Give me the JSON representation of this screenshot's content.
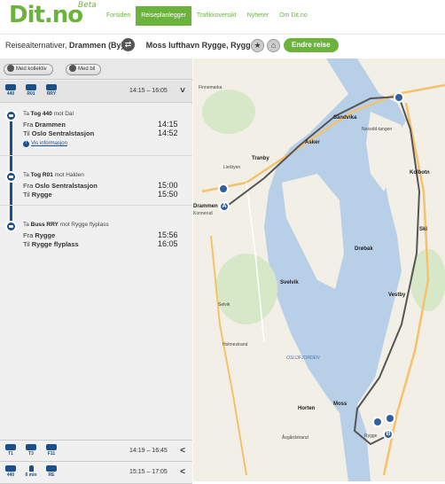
{
  "header": {
    "logo": "Dit.no",
    "logo_beta": "Beta",
    "nav": [
      "Forsiden",
      "Reiseplanlegger",
      "Trafikkoversikt",
      "Nyheter",
      "Om Dit.no"
    ]
  },
  "route": {
    "prefix": "Reisealternativer, ",
    "from": "Drammen (By)",
    "to": "Moss lufthavn Rygge, Rygge",
    "swap_icon": "swap-arrows-icon",
    "change_label": "Endre reise"
  },
  "modes": {
    "transit_label": "Med kollektiv",
    "car_label": "Med bil"
  },
  "alternatives": [
    {
      "legs": [
        {
          "icon": "train-icon",
          "code": "440"
        },
        {
          "icon": "train-icon",
          "code": "R01"
        },
        {
          "icon": "bus-icon",
          "code": "RRY"
        }
      ],
      "time": "14:15 – 16:05",
      "chevron": "˅"
    },
    {
      "legs": [
        {
          "icon": "bus-icon",
          "code": "T1"
        },
        {
          "icon": "bus-icon",
          "code": "T3"
        },
        {
          "icon": "ferry-icon",
          "code": "F11"
        }
      ],
      "time": "14:19 – 16:45",
      "chevron": "<"
    },
    {
      "legs": [
        {
          "icon": "train-icon",
          "code": "440"
        },
        {
          "icon": "walk-icon",
          "code": "6 min"
        },
        {
          "icon": "train-icon",
          "code": "RE"
        }
      ],
      "time": "15:15 – 17:05",
      "chevron": "<"
    }
  ],
  "steps": [
    {
      "head_prefix": "Ta ",
      "vehicle": "Tog 440",
      "head_suffix": " mot Dal",
      "from_label": "Fra",
      "from": "Drammen",
      "to_label": "Til",
      "to": "Oslo Sentralstasjon",
      "dep": "14:15",
      "arr": "14:52",
      "info": "Vis informasjon"
    },
    {
      "head_prefix": "Ta ",
      "vehicle": "Tog R01",
      "head_suffix": " mot Halden",
      "from_label": "Fra",
      "from": "Oslo Sentralstasjon",
      "to_label": "Til",
      "to": "Rygge",
      "dep": "15:00",
      "arr": "15:50"
    },
    {
      "head_prefix": "Ta ",
      "vehicle": "Buss RRY",
      "head_suffix": " mot Rygge flyplass",
      "from_label": "Fra",
      "from": "Rygge",
      "to_label": "Til",
      "to": "Rygge flyplass",
      "dep": "15:56",
      "arr": "16:05"
    }
  ],
  "map": {
    "labels": [
      "Finnemarka",
      "Sandvika",
      "Asker",
      "Nesodd-tangen",
      "Tranby",
      "Lierbyen",
      "Drammen",
      "Konnerud",
      "Kolbotn",
      "Ski",
      "Drøbak",
      "Svelvik",
      "Vestby",
      "OSLOFJORDEN",
      "Horten",
      "Moss",
      "Rygge",
      "Åsgårdstrand",
      "Holmestrand",
      "Selvik"
    ],
    "pin_a": "A",
    "pin_b": "B",
    "colors": {
      "water": "#b8cfe8",
      "land": "#f2efe6",
      "route": "#555555",
      "road": "#f5c26b",
      "pin": "#2f5f9c"
    }
  }
}
